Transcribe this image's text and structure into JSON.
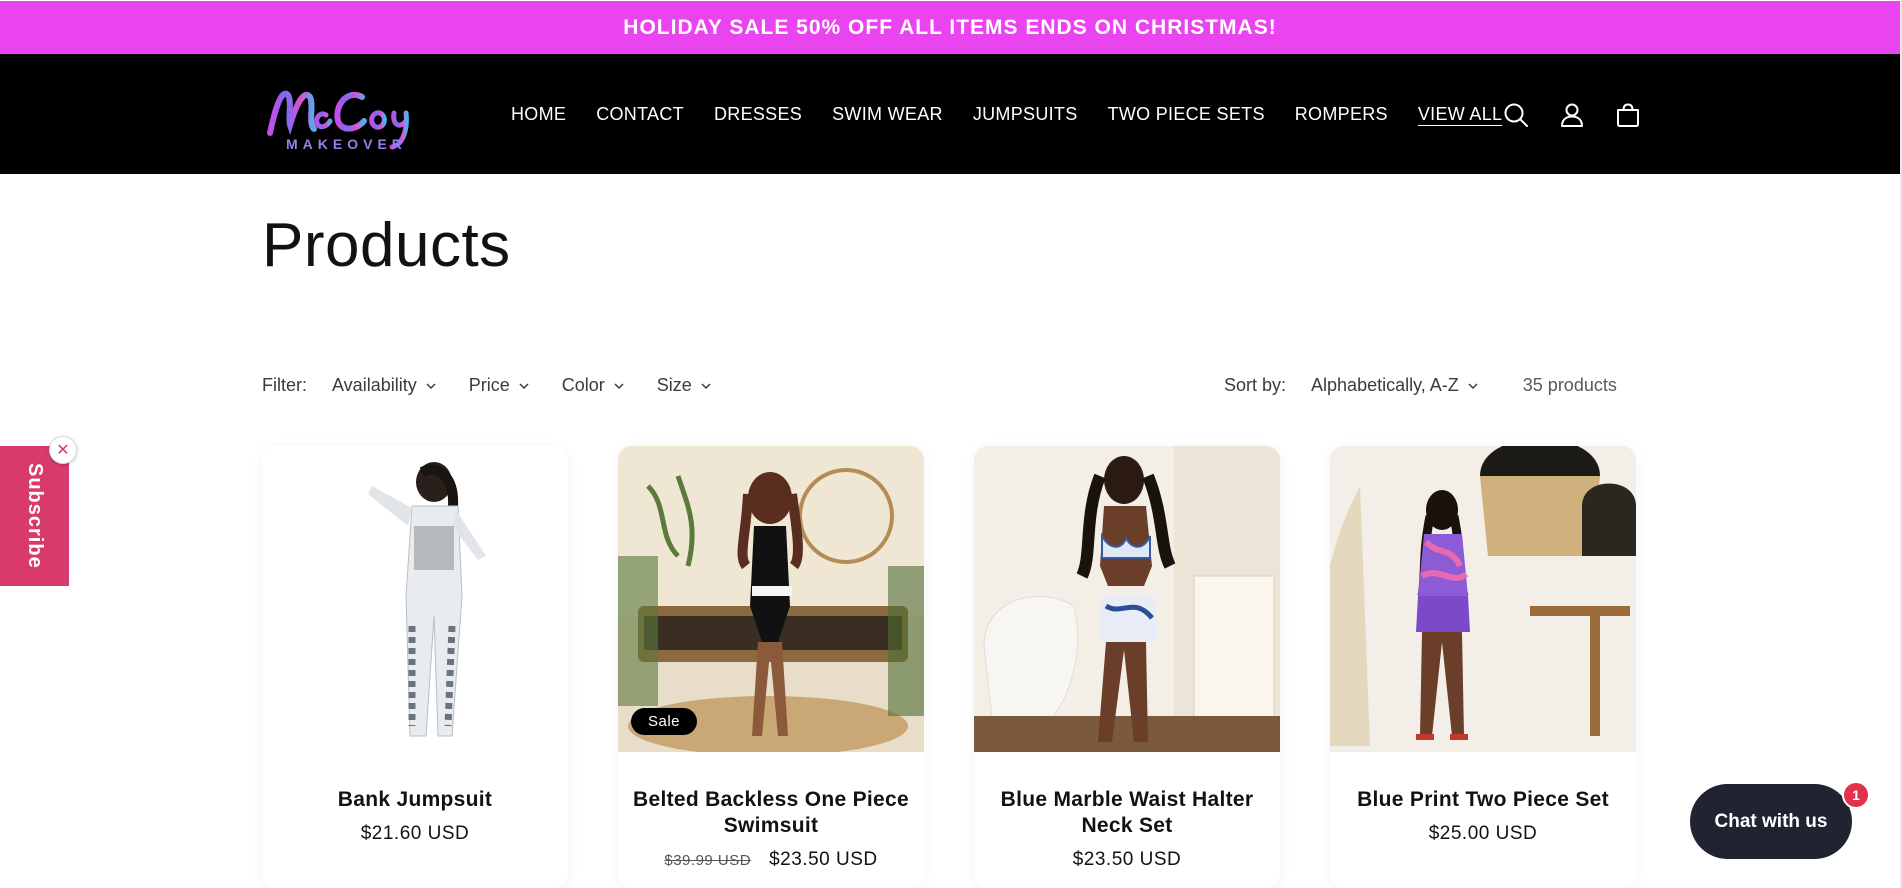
{
  "announcement": "HOLIDAY SALE 50% OFF ALL ITEMS ENDS ON CHRISTMAS!",
  "brand": {
    "logo_script": "McCoy",
    "logo_sub": "MAKEOVER"
  },
  "nav": [
    {
      "label": "HOME",
      "active": false
    },
    {
      "label": "CONTACT",
      "active": false
    },
    {
      "label": "DRESSES",
      "active": false
    },
    {
      "label": "SWIM WEAR",
      "active": false
    },
    {
      "label": "JUMPSUITS",
      "active": false
    },
    {
      "label": "TWO PIECE SETS",
      "active": false
    },
    {
      "label": "ROMPERS",
      "active": false
    },
    {
      "label": "VIEW ALL",
      "active": true
    }
  ],
  "header_icons": [
    "search-icon",
    "account-icon",
    "cart-icon"
  ],
  "page_title": "Products",
  "filters": {
    "label": "Filter:",
    "items": [
      "Availability",
      "Price",
      "Color",
      "Size"
    ]
  },
  "sort": {
    "label": "Sort by:",
    "value": "Alphabetically, A-Z"
  },
  "product_count": "35 products",
  "subscribe": {
    "label": "Subscribe",
    "close": "✕"
  },
  "products": [
    {
      "title": "Bank Jumpsuit",
      "price": "$21.60 USD",
      "compare_price": "",
      "badge": ""
    },
    {
      "title": "Belted Backless One Piece Swimsuit",
      "price": "$23.50 USD",
      "compare_price": "$39.99 USD",
      "badge": "Sale"
    },
    {
      "title": "Blue Marble Waist Halter Neck Set",
      "price": "$23.50 USD",
      "compare_price": "",
      "badge": ""
    },
    {
      "title": "Blue Print Two Piece Set",
      "price": "$25.00 USD",
      "compare_price": "",
      "badge": ""
    }
  ],
  "chat": {
    "label": "Chat with us",
    "unread": "1"
  },
  "colors": {
    "announcement_bg": "#ea43f0",
    "header_bg": "#000000",
    "subscribe_bg": "#d83a6c",
    "chat_bg": "#1f2430",
    "chat_badge": "#e0334b"
  }
}
